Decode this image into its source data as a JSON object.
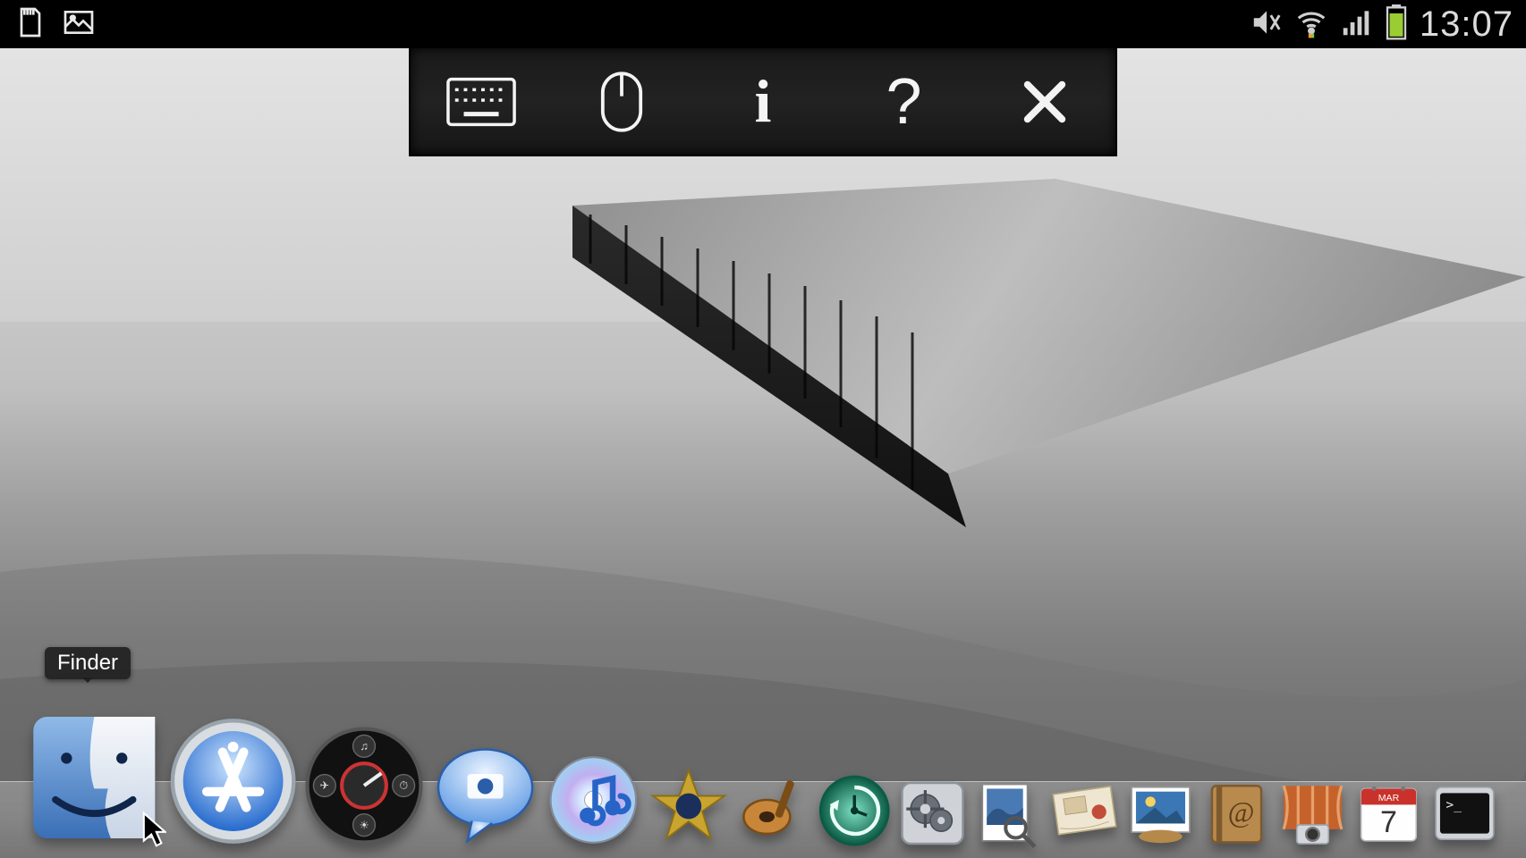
{
  "status_bar": {
    "left_icons": [
      "sdcard-icon",
      "picture-icon"
    ],
    "right_icons": [
      "mute-icon",
      "wifi-icon",
      "signal-icon",
      "battery-icon"
    ],
    "clock": "13:07"
  },
  "remote_toolbar": {
    "items": [
      {
        "name": "keyboard-button",
        "icon": "keyboard-icon"
      },
      {
        "name": "mouse-button",
        "icon": "mouse-icon"
      },
      {
        "name": "info-button",
        "icon": "info-icon"
      },
      {
        "name": "help-button",
        "icon": "help-icon"
      },
      {
        "name": "close-button",
        "icon": "close-icon"
      }
    ]
  },
  "tooltip": {
    "label": "Finder"
  },
  "dock": {
    "items": [
      {
        "name": "finder",
        "label": "Finder"
      },
      {
        "name": "app-store",
        "label": "App Store"
      },
      {
        "name": "dashboard",
        "label": "Dashboard"
      },
      {
        "name": "ichat",
        "label": "iChat"
      },
      {
        "name": "itunes",
        "label": "iTunes"
      },
      {
        "name": "imovie",
        "label": "iMovie"
      },
      {
        "name": "garageband",
        "label": "GarageBand"
      },
      {
        "name": "time-machine",
        "label": "Time Machine"
      },
      {
        "name": "system-prefs",
        "label": "System Preferences"
      },
      {
        "name": "preview",
        "label": "Preview"
      },
      {
        "name": "mail",
        "label": "Mail"
      },
      {
        "name": "iphoto",
        "label": "iPhoto"
      },
      {
        "name": "address-book",
        "label": "Address Book"
      },
      {
        "name": "photo-booth",
        "label": "Photo Booth"
      },
      {
        "name": "ical",
        "label": "iCal",
        "day": "7",
        "month": "MAR"
      },
      {
        "name": "terminal",
        "label": "Terminal"
      }
    ]
  }
}
